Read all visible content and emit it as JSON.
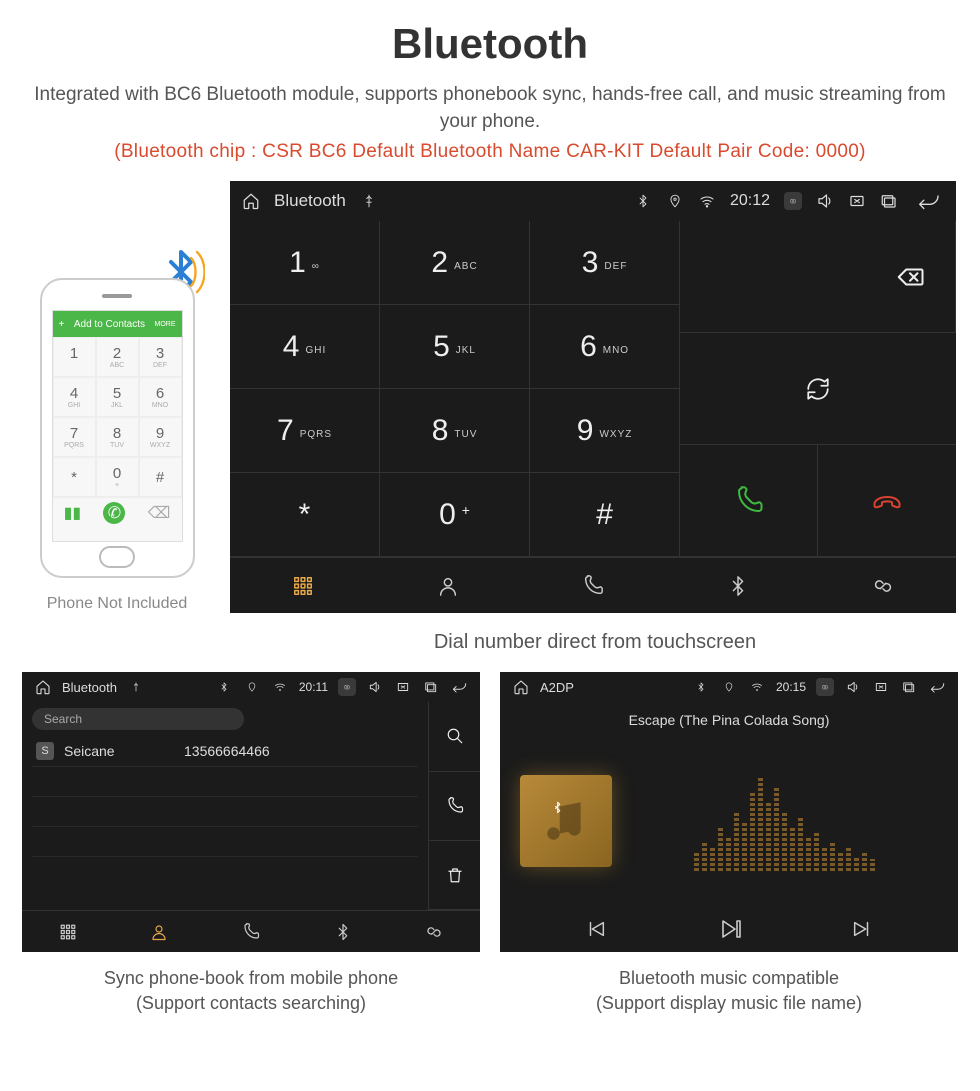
{
  "title": "Bluetooth",
  "subtitle": "Integrated with BC6 Bluetooth module, supports phonebook sync, hands-free call, and music streaming from your phone.",
  "specs": "(Bluetooth chip : CSR BC6     Default Bluetooth Name CAR-KIT     Default Pair Code: 0000)",
  "phone": {
    "barLeft": "+",
    "barText": "Add to Contacts",
    "barRight": "MORE",
    "caption": "Phone Not Included"
  },
  "mainScreen": {
    "app": "Bluetooth",
    "time": "20:12",
    "keys": [
      {
        "n": "1",
        "s": "∞"
      },
      {
        "n": "2",
        "s": "ABC"
      },
      {
        "n": "3",
        "s": "DEF"
      },
      {
        "n": "4",
        "s": "GHI"
      },
      {
        "n": "5",
        "s": "JKL"
      },
      {
        "n": "6",
        "s": "MNO"
      },
      {
        "n": "7",
        "s": "PQRS"
      },
      {
        "n": "8",
        "s": "TUV"
      },
      {
        "n": "9",
        "s": "WXYZ"
      },
      {
        "n": "*",
        "s": ""
      },
      {
        "n": "0",
        "s": "+",
        "plus": true
      },
      {
        "n": "#",
        "s": ""
      }
    ],
    "caption": "Dial number direct from touchscreen"
  },
  "pbScreen": {
    "app": "Bluetooth",
    "time": "20:11",
    "search": "Search",
    "contact": {
      "badge": "S",
      "name": "Seicane",
      "number": "13566664466"
    },
    "caption1": "Sync phone-book from mobile phone",
    "caption2": "(Support contacts searching)"
  },
  "musicScreen": {
    "app": "A2DP",
    "time": "20:15",
    "track": "Escape (The Pina Colada Song)",
    "caption1": "Bluetooth music compatible",
    "caption2": "(Support display music file name)"
  }
}
